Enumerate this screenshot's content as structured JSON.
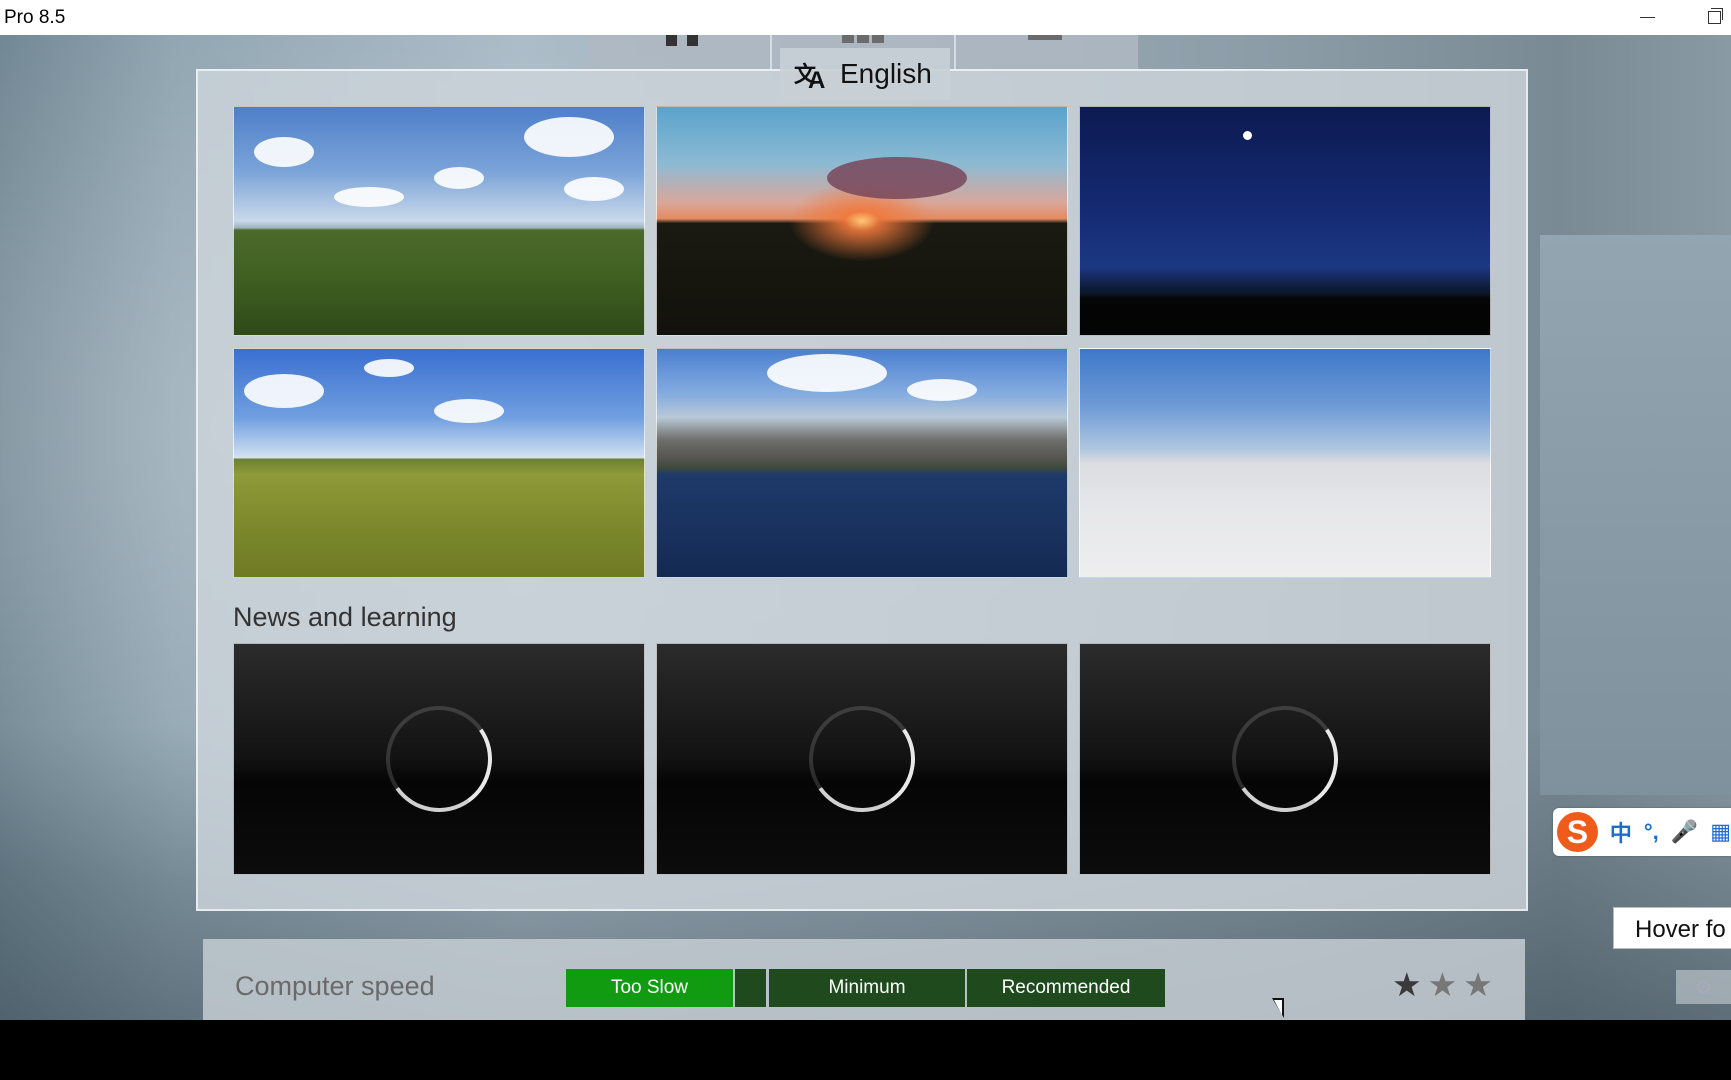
{
  "window": {
    "title": "Pro 8.5",
    "minimize_icon": "minimize-icon",
    "restore_icon": "restore-icon"
  },
  "language": {
    "label": "English",
    "icon": "translate-icon"
  },
  "environments": [
    {
      "name": "clear-day-grass"
    },
    {
      "name": "sunset-field"
    },
    {
      "name": "night-sky"
    },
    {
      "name": "hills-meadow"
    },
    {
      "name": "mountain-lake"
    },
    {
      "name": "plain-sky-white-ground"
    }
  ],
  "news": {
    "title": "News and learning",
    "items": [
      {
        "state": "loading"
      },
      {
        "state": "loading"
      },
      {
        "state": "loading"
      }
    ]
  },
  "computer_speed": {
    "label": "Computer speed",
    "levels": [
      "Too Slow",
      "Minimum",
      "Recommended"
    ],
    "active_level": "Too Slow",
    "rating": 1,
    "max_rating": 3,
    "colors": {
      "active": "#119b11",
      "inactive": "#1e4a1e"
    }
  },
  "ime": {
    "logo": "S",
    "items": [
      "中",
      "°,",
      "mic-icon",
      "grid-icon"
    ]
  },
  "tooltip": {
    "text": "Hover fo"
  }
}
